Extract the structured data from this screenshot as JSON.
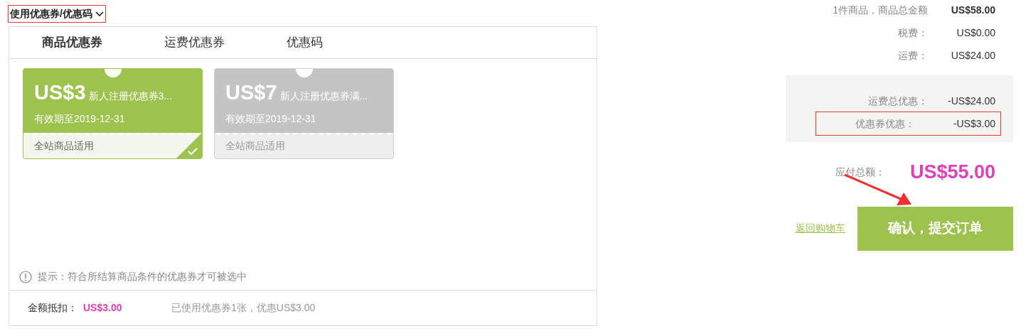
{
  "coupon_section": {
    "toggle_label": "使用优惠券/优惠码",
    "expanded": true,
    "highlighted": true,
    "tabs": [
      {
        "label": "商品优惠券",
        "selected": true
      },
      {
        "label": "运费优惠券",
        "selected": false
      },
      {
        "label": "优惠码",
        "selected": false
      }
    ],
    "coupons": [
      {
        "amount": "US$3",
        "title": "新人注册优惠券3...",
        "validity": "有效期至2019-12-31",
        "scope": "全站商品适用",
        "selected": true
      },
      {
        "amount": "US$7",
        "title": "新人注册优惠券满...",
        "validity": "有效期至2019-12-31",
        "scope": "全站商品适用",
        "selected": false
      }
    ],
    "hint": "提示：符合所结算商品条件的优惠券才可被选中",
    "deduction_label": "金额抵扣：",
    "deduction_value": "US$3.00",
    "usage_note": "已使用优惠券1张，优惠US$3.00"
  },
  "summary": {
    "rows": [
      {
        "label": "1件商品，商品总金额",
        "value": "US$58.00",
        "bold": true
      },
      {
        "label": "税费：",
        "value": "US$0.00",
        "bold": false
      },
      {
        "label": "运费：",
        "value": "US$24.00",
        "bold": false
      }
    ],
    "discounts": [
      {
        "label": "运费总优惠：",
        "value": "-US$24.00",
        "highlighted": false
      },
      {
        "label": "优惠券优惠：",
        "value": "-US$3.00",
        "highlighted": true
      }
    ],
    "total_label": "应付总额：",
    "total_value": "US$55.00",
    "back_link": "返回购物车",
    "submit_button": "确认，提交订单"
  }
}
